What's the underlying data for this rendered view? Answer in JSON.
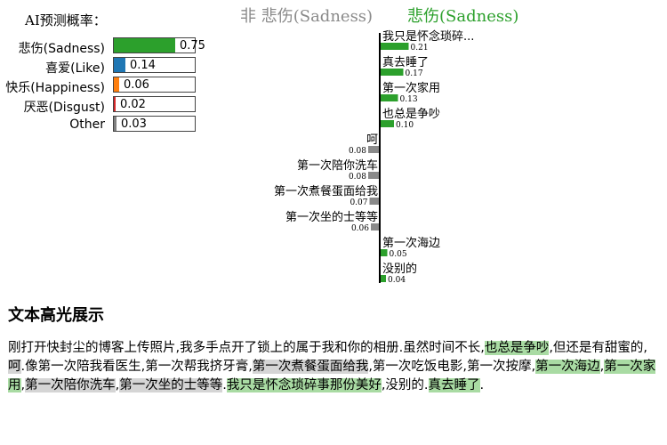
{
  "prediction_panel": {
    "title": "AI预测概率：",
    "items": [
      {
        "label": "悲伤(Sadness)",
        "value": 0.75,
        "display": "0.75",
        "color": "#2ca02c"
      },
      {
        "label": "喜爱(Like)",
        "value": 0.14,
        "display": "0.14",
        "color": "#1f77b4"
      },
      {
        "label": "快乐(Happiness)",
        "value": 0.06,
        "display": "0.06",
        "color": "#ff7f0e"
      },
      {
        "label": "厌恶(Disgust)",
        "value": 0.02,
        "display": "0.02",
        "color": "#d62728"
      },
      {
        "label": "Other",
        "value": 0.03,
        "display": "0.03",
        "color": "#7f7f7f"
      }
    ]
  },
  "chart_data": {
    "type": "bar",
    "orientation": "horizontal-diverging",
    "title_negative": "非 悲伤(Sadness)",
    "title_positive": "悲伤(Sadness)",
    "colors": {
      "positive": "#2ca02c",
      "negative": "#8a8a8a"
    },
    "items": [
      {
        "label": "我只是怀念琐碎...",
        "value": 0.21,
        "display": "0.21",
        "side": "positive"
      },
      {
        "label": "真去睡了",
        "value": 0.17,
        "display": "0.17",
        "side": "positive"
      },
      {
        "label": "第一次家用",
        "value": 0.13,
        "display": "0.13",
        "side": "positive"
      },
      {
        "label": "也总是争吵",
        "value": 0.1,
        "display": "0.10",
        "side": "positive"
      },
      {
        "label": "呵",
        "value": 0.08,
        "display": "0.08",
        "side": "negative"
      },
      {
        "label": "第一次陪你洗车",
        "value": 0.08,
        "display": "0.08",
        "side": "negative"
      },
      {
        "label": "第一次煮餐蛋面给我",
        "value": 0.07,
        "display": "0.07",
        "side": "negative"
      },
      {
        "label": "第一次坐的士等等",
        "value": 0.06,
        "display": "0.06",
        "side": "negative"
      },
      {
        "label": "第一次海边",
        "value": 0.05,
        "display": "0.05",
        "side": "positive"
      },
      {
        "label": "没别的",
        "value": 0.04,
        "display": "0.04",
        "side": "positive"
      }
    ]
  },
  "highlight_section": {
    "title": "文本高光展示",
    "segments": [
      {
        "text": "刚打开快封尘的博客上传照片,我多手点开了锁上的属于我和你的相册.虽然时间不长,",
        "type": "none"
      },
      {
        "text": "也总是争吵",
        "type": "pos"
      },
      {
        "text": ",但还是有甜蜜的,",
        "type": "none"
      },
      {
        "text": "呵",
        "type": "neg"
      },
      {
        "text": ".像第一次陪我看医生,第一次帮我挤牙膏,",
        "type": "none"
      },
      {
        "text": "第一次煮餐蛋面给我",
        "type": "neg"
      },
      {
        "text": ",第一次吃饭电影,第一次按摩,",
        "type": "none"
      },
      {
        "text": "第一次海边",
        "type": "pos"
      },
      {
        "text": ",",
        "type": "none"
      },
      {
        "text": "第一次家用",
        "type": "pos"
      },
      {
        "text": ",",
        "type": "none"
      },
      {
        "text": "第一次陪你洗车",
        "type": "neg"
      },
      {
        "text": ",",
        "type": "none"
      },
      {
        "text": "第一次坐的士等等",
        "type": "neg"
      },
      {
        "text": ".",
        "type": "none"
      },
      {
        "text": "我只是怀念琐碎事那份美好",
        "type": "pos"
      },
      {
        "text": ",没别的.",
        "type": "none"
      },
      {
        "text": "真去睡了",
        "type": "pos"
      },
      {
        "text": ".",
        "type": "none"
      }
    ]
  }
}
